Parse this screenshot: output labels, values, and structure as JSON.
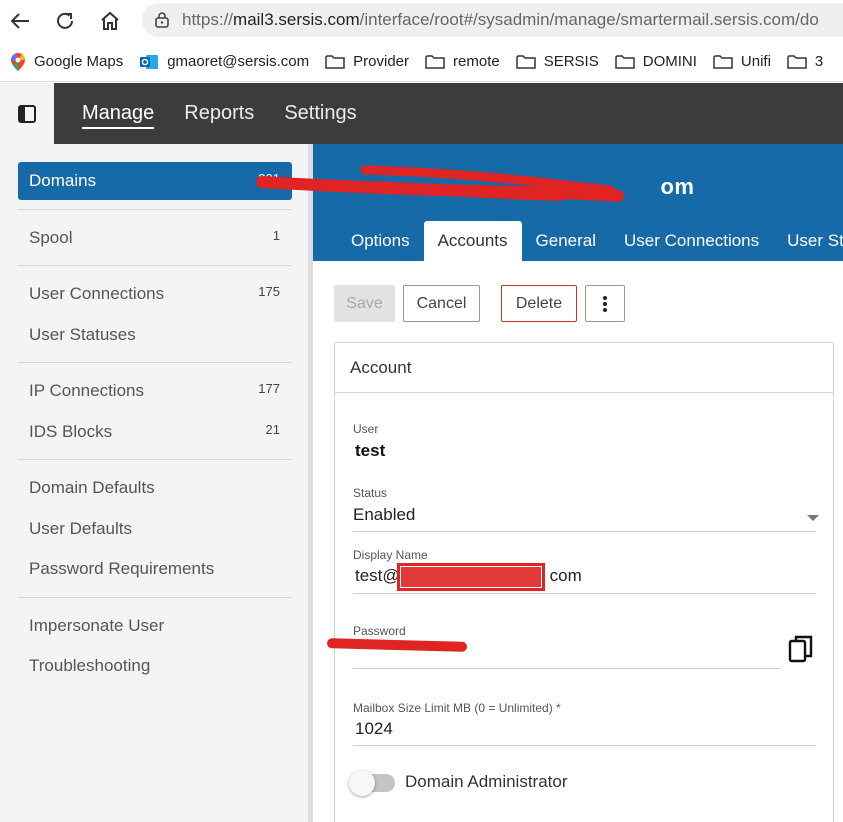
{
  "browser": {
    "url_proto": "https://",
    "url_host": "mail3.sersis.com",
    "url_path": "/interface/root#/sysadmin/manage/smartermail.sersis.com/do",
    "bookmarks": [
      "Google Maps",
      "gmaoret@sersis.com",
      "Provider",
      "remote",
      "SERSIS",
      "DOMINI",
      "Unifi",
      "3"
    ]
  },
  "topnav": {
    "items": [
      "Manage",
      "Reports",
      "Settings"
    ],
    "active": "Manage"
  },
  "sidebar": {
    "items": [
      {
        "label": "Domains",
        "count": "201"
      },
      {
        "label": "Spool",
        "count": "1"
      },
      {
        "label": "User Connections",
        "count": "175"
      },
      {
        "label": "User Statuses",
        "count": ""
      },
      {
        "label": "IP Connections",
        "count": "177"
      },
      {
        "label": "IDS Blocks",
        "count": "21"
      },
      {
        "label": "Domain Defaults",
        "count": ""
      },
      {
        "label": "User Defaults",
        "count": ""
      },
      {
        "label": "Password Requirements",
        "count": ""
      },
      {
        "label": "Impersonate User",
        "count": ""
      },
      {
        "label": "Troubleshooting",
        "count": ""
      }
    ]
  },
  "domain": {
    "title_visible": "om"
  },
  "tabs": [
    "Options",
    "Accounts",
    "General",
    "User Connections",
    "User St"
  ],
  "toolbar": {
    "save": "Save",
    "cancel": "Cancel",
    "delete": "Delete"
  },
  "account": {
    "heading": "Account",
    "user_label": "User",
    "user_value": "test",
    "status_label": "Status",
    "status_value": "Enabled",
    "display_name_label": "Display Name",
    "display_name_prefix": "test@",
    "display_name_suffix": "com",
    "password_label": "Password",
    "mailbox_label": "Mailbox Size Limit MB (0 = Unlimited) *",
    "mailbox_value": "1024",
    "domain_admin_label": "Domain Administrator"
  },
  "colors": {
    "accent": "#166aa7",
    "nav_bg": "#3c3c3c",
    "delete_border": "#c0392b",
    "redaction": "#e02323"
  }
}
